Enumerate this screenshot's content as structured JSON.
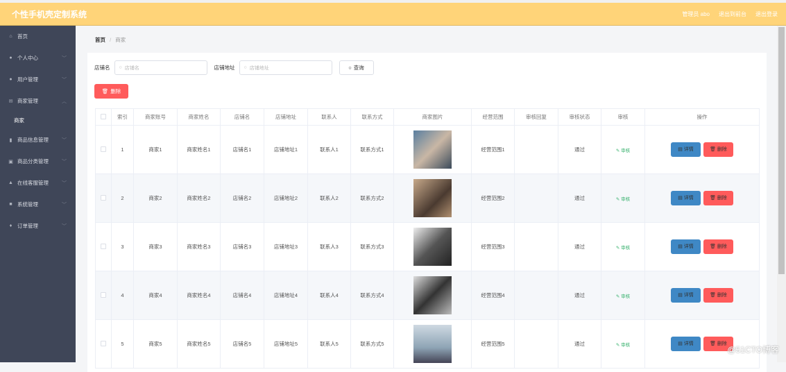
{
  "header": {
    "title": "个性手机壳定制系统",
    "user": "管理员 abo",
    "to_front": "退出到前台",
    "logout": "退出登录"
  },
  "sidebar": {
    "items": [
      {
        "label": "首页",
        "icon": "home-icon",
        "chevron": false
      },
      {
        "label": "个人中心",
        "icon": "user-icon",
        "chevron": true
      },
      {
        "label": "用户管理",
        "icon": "user-icon",
        "chevron": true
      },
      {
        "label": "商家管理",
        "icon": "mail-icon",
        "chevron": true,
        "open": true,
        "sub": [
          "商家"
        ]
      },
      {
        "label": "商品信息管理",
        "icon": "chart-icon",
        "chevron": true
      },
      {
        "label": "商品分类管理",
        "icon": "clipboard-icon",
        "chevron": true
      },
      {
        "label": "在线客服管理",
        "icon": "chat-icon",
        "chevron": true
      },
      {
        "label": "系统管理",
        "icon": "briefcase-icon",
        "chevron": true
      },
      {
        "label": "订单管理",
        "icon": "mic-icon",
        "chevron": true
      }
    ]
  },
  "breadcrumb": {
    "home": "首页",
    "sep": "/",
    "current": "商家"
  },
  "search": {
    "shop_label": "店铺名",
    "shop_placeholder": "店铺名",
    "addr_label": "店铺地址",
    "addr_placeholder": "店铺地址",
    "query": "查询"
  },
  "delete_label": "删除",
  "table": {
    "headers": [
      "索引",
      "商家账号",
      "商家姓名",
      "店铺名",
      "店铺地址",
      "联系人",
      "联系方式",
      "商家图片",
      "经营范围",
      "审核回复",
      "审核状态",
      "审核",
      "操作"
    ],
    "rows": [
      {
        "idx": "1",
        "account": "商家1",
        "name": "商家姓名1",
        "shop": "店铺名1",
        "addr": "店铺地址1",
        "contact": "联系人1",
        "phone": "联系方式1",
        "scope": "经营范围1",
        "reply": "",
        "status": "通过"
      },
      {
        "idx": "2",
        "account": "商家2",
        "name": "商家姓名2",
        "shop": "店铺名2",
        "addr": "店铺地址2",
        "contact": "联系人2",
        "phone": "联系方式2",
        "scope": "经营范围2",
        "reply": "",
        "status": "通过"
      },
      {
        "idx": "3",
        "account": "商家3",
        "name": "商家姓名3",
        "shop": "店铺名3",
        "addr": "店铺地址3",
        "contact": "联系人3",
        "phone": "联系方式3",
        "scope": "经营范围3",
        "reply": "",
        "status": "通过"
      },
      {
        "idx": "4",
        "account": "商家4",
        "name": "商家姓名4",
        "shop": "店铺名4",
        "addr": "店铺地址4",
        "contact": "联系人4",
        "phone": "联系方式4",
        "scope": "经营范围4",
        "reply": "",
        "status": "通过"
      },
      {
        "idx": "5",
        "account": "商家5",
        "name": "商家姓名5",
        "shop": "店铺名5",
        "addr": "店铺地址5",
        "contact": "联系人5",
        "phone": "联系方式5",
        "scope": "经营范围5",
        "reply": "",
        "status": "通过"
      }
    ],
    "audit_label": "审核",
    "detail_label": "详情",
    "delete_label": "删除"
  },
  "watermark": "@51CTO博客",
  "colors": {
    "header": "#ffd479",
    "sidebar": "#3f4658",
    "primary": "#3f88c5",
    "danger": "#ff5b5b",
    "success": "#3cb371"
  }
}
